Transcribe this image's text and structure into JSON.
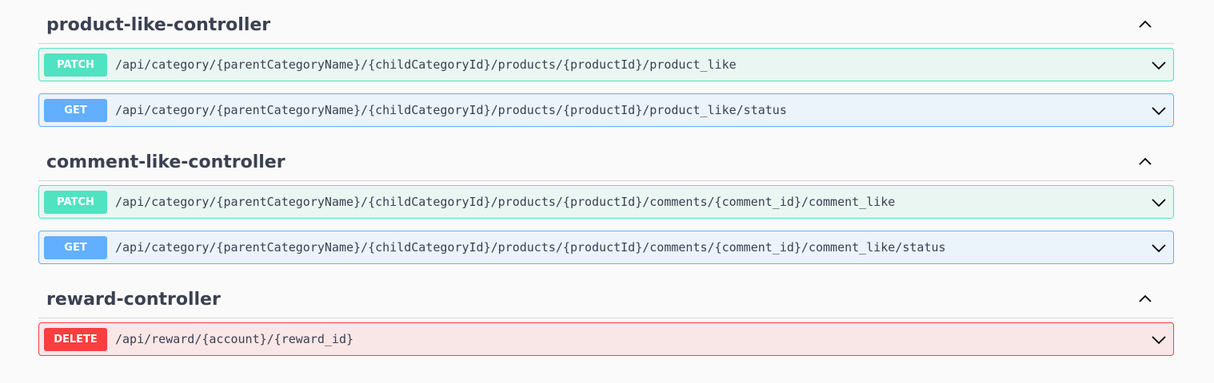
{
  "sections": [
    {
      "title": "product-like-controller",
      "toggle_icon": "chevron-up-icon",
      "operations": [
        {
          "method": "PATCH",
          "path": "/api/category/{parentCategoryName}/{childCategoryId}/products/{productId}/product_like",
          "icon": "chevron-down-icon",
          "color": "#50e3c2"
        },
        {
          "method": "GET",
          "path": "/api/category/{parentCategoryName}/{childCategoryId}/products/{productId}/product_like/status",
          "icon": "chevron-down-icon",
          "color": "#61affe"
        }
      ]
    },
    {
      "title": "comment-like-controller",
      "toggle_icon": "chevron-up-icon",
      "operations": [
        {
          "method": "PATCH",
          "path": "/api/category/{parentCategoryName}/{childCategoryId}/products/{productId}/comments/{comment_id}/comment_like",
          "icon": "chevron-down-icon",
          "color": "#50e3c2"
        },
        {
          "method": "GET",
          "path": "/api/category/{parentCategoryName}/{childCategoryId}/products/{productId}/comments/{comment_id}/comment_like/status",
          "icon": "chevron-down-icon",
          "color": "#61affe"
        }
      ]
    },
    {
      "title": "reward-controller",
      "toggle_icon": "chevron-up-icon",
      "operations": [
        {
          "method": "DELETE",
          "path": "/api/reward/{account}/{reward_id}",
          "icon": "chevron-down-icon",
          "color": "#f93e3e"
        }
      ]
    }
  ]
}
